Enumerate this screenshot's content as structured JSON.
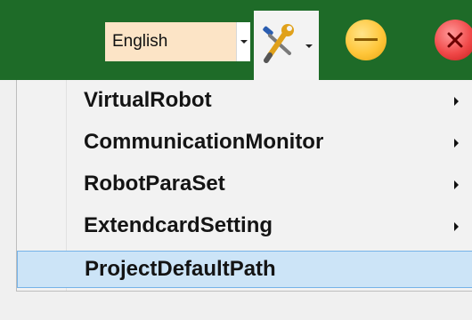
{
  "toolbar": {
    "language_value": "English",
    "language_icon": "dropdown-arrow",
    "tools_icon": "wrench-screwdriver",
    "minimize_icon": "minimize-circle",
    "close_icon": "close-circle",
    "colors": {
      "titlebar": "#1e6b28",
      "language_bg": "#fce4c6",
      "minimize": "#ffc63a",
      "close": "#f04848",
      "highlight": "#cce4f7"
    }
  },
  "menu": {
    "items": [
      {
        "label": "VirtualRobot",
        "has_submenu": true
      },
      {
        "label": "CommunicationMonitor",
        "has_submenu": true
      },
      {
        "label": "RobotParaSet",
        "has_submenu": true
      },
      {
        "label": "ExtendcardSetting",
        "has_submenu": true
      },
      {
        "label": "ProjectDefaultPath",
        "has_submenu": false,
        "highlighted": true
      }
    ]
  }
}
